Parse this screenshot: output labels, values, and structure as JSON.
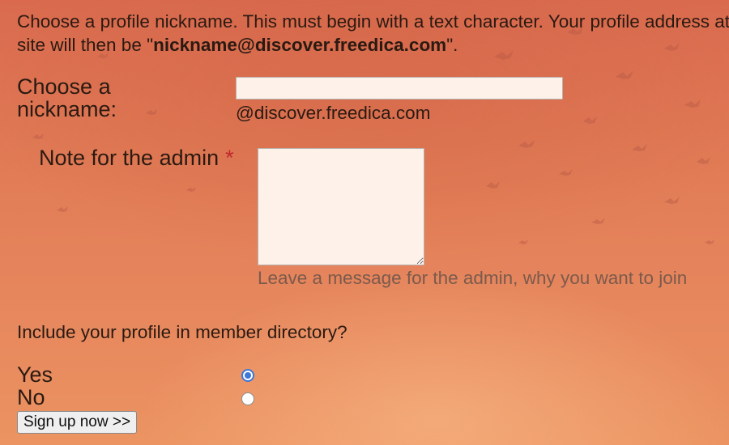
{
  "intro": {
    "line1": "Choose a profile nickname. This must begin with a text character. Your profile address at this",
    "line2_prefix": "site will then be \"",
    "line2_bold": "nickname@discover.freedica.com",
    "line2_suffix": "\"."
  },
  "nickname": {
    "label": "Choose a nickname:",
    "value": "",
    "placeholder": "",
    "domain_suffix": "@discover.freedica.com"
  },
  "admin_note": {
    "label": "Note for the admin",
    "required_marker": "*",
    "value": "",
    "hint": "Leave a message for the admin, why you want to join"
  },
  "directory": {
    "question": "Include your profile in member directory?",
    "options": [
      {
        "label": "Yes",
        "checked": true
      },
      {
        "label": "No",
        "checked": false
      }
    ]
  },
  "submit": {
    "label": "Sign up now >>"
  },
  "colors": {
    "background_top": "#d96a4e",
    "background_bottom": "#ec9462",
    "required": "#c1272d",
    "radio_accent": "#3b78d8",
    "hint_text": "#7b5a4c"
  }
}
